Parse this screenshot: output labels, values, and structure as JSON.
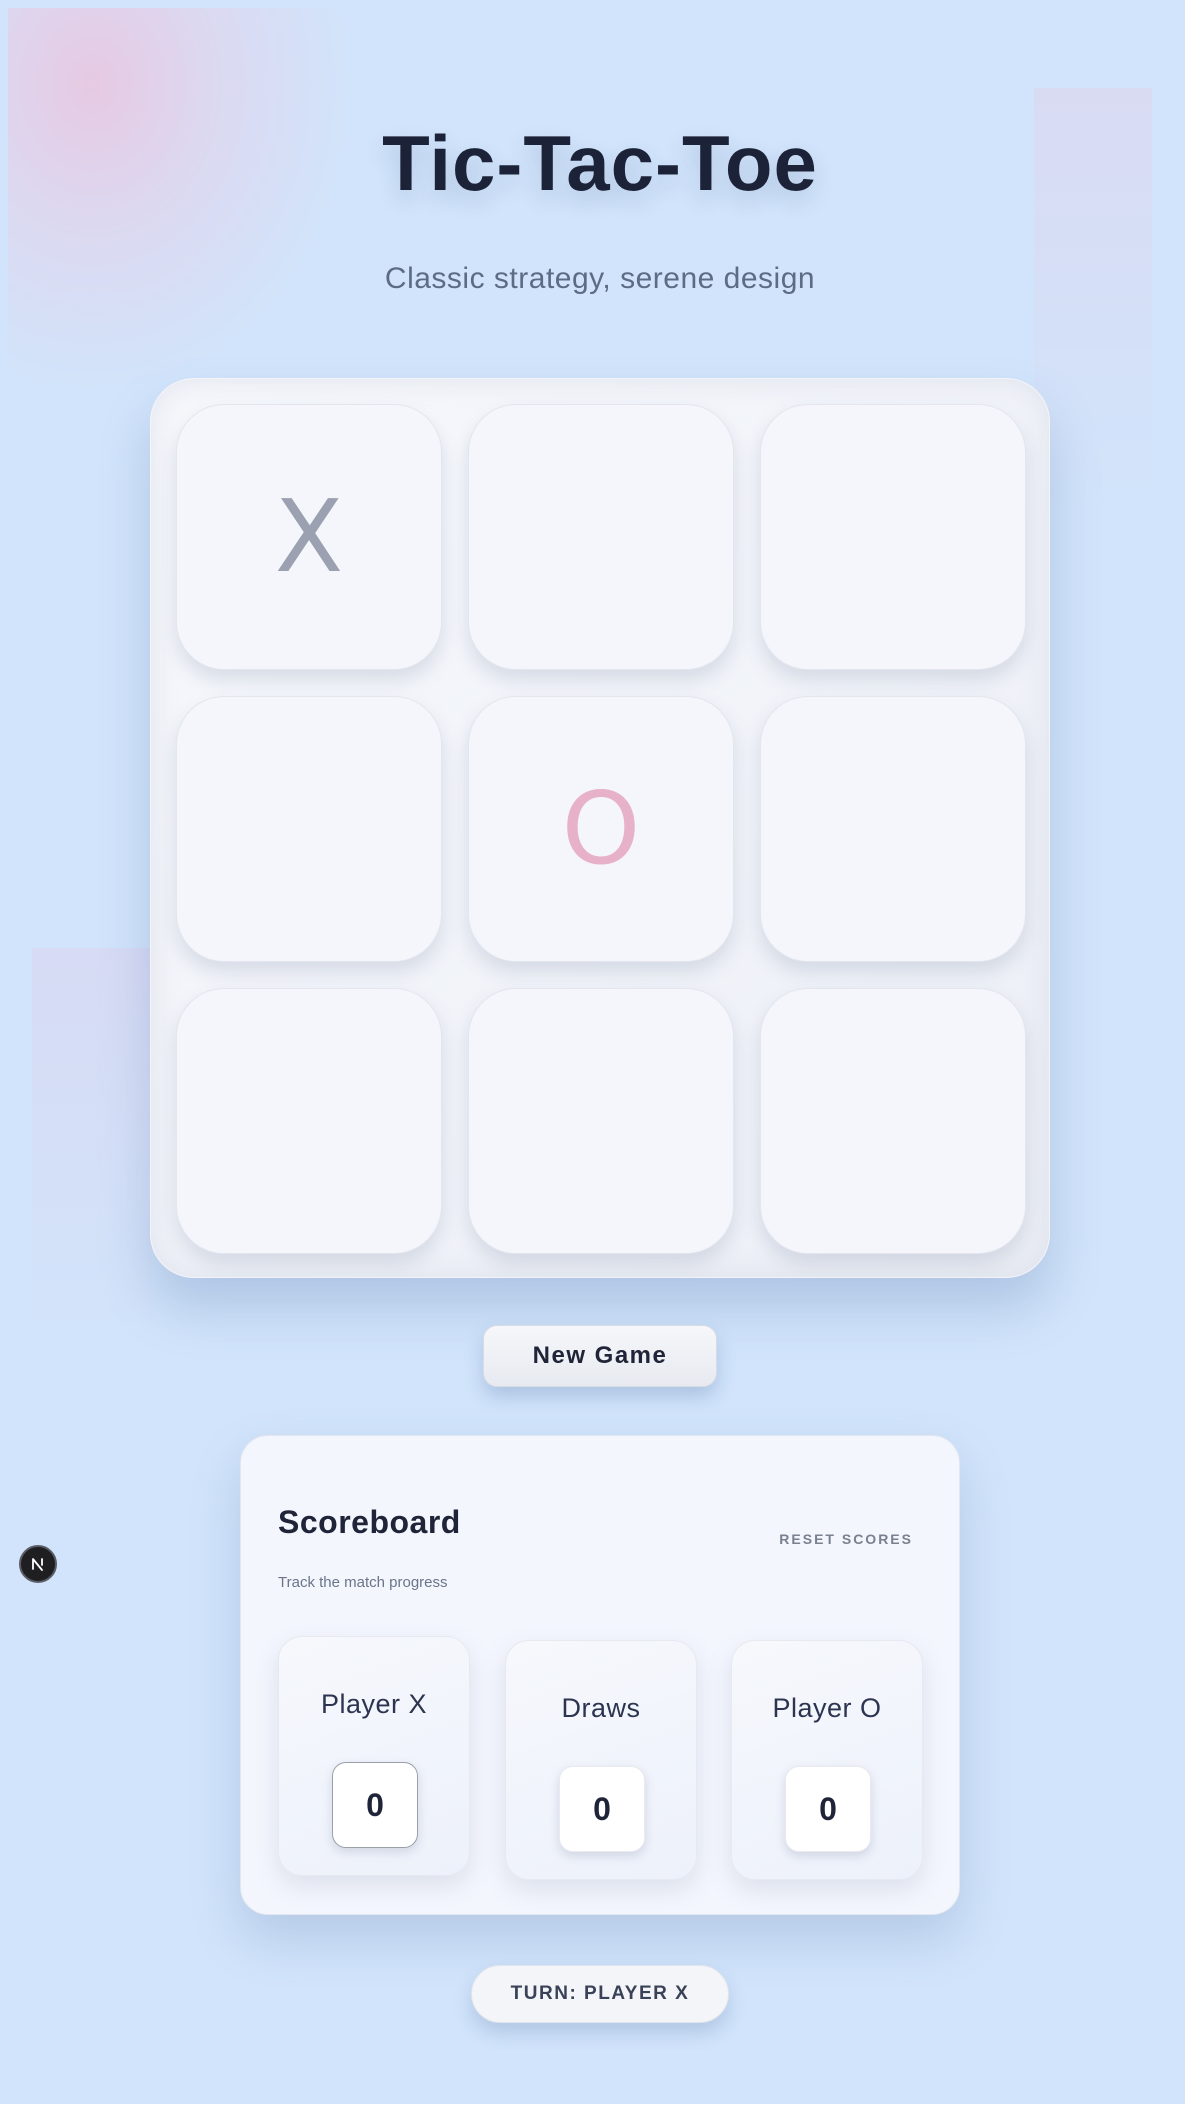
{
  "header": {
    "title": "Tic-Tac-Toe",
    "subtitle": "Classic strategy, serene design"
  },
  "board": {
    "cells": [
      "X",
      "",
      "",
      "",
      "O",
      "",
      "",
      "",
      ""
    ]
  },
  "controls": {
    "new_game_label": "New Game"
  },
  "scoreboard": {
    "title": "Scoreboard",
    "subtitle": "Track the match progress",
    "reset_label": "RESET SCORES",
    "cards": [
      {
        "label": "Player X",
        "value": "0"
      },
      {
        "label": "Draws",
        "value": "0"
      },
      {
        "label": "Player O",
        "value": "0"
      }
    ]
  },
  "status": {
    "turn_text": "TURN: PLAYER X"
  },
  "colors": {
    "background": "#d1e4fb",
    "mark_x": "#9ba1b1",
    "mark_o": "#e7b2c9",
    "title": "#1c2238"
  },
  "badge": {
    "icon": "nextjs-logo-icon"
  }
}
